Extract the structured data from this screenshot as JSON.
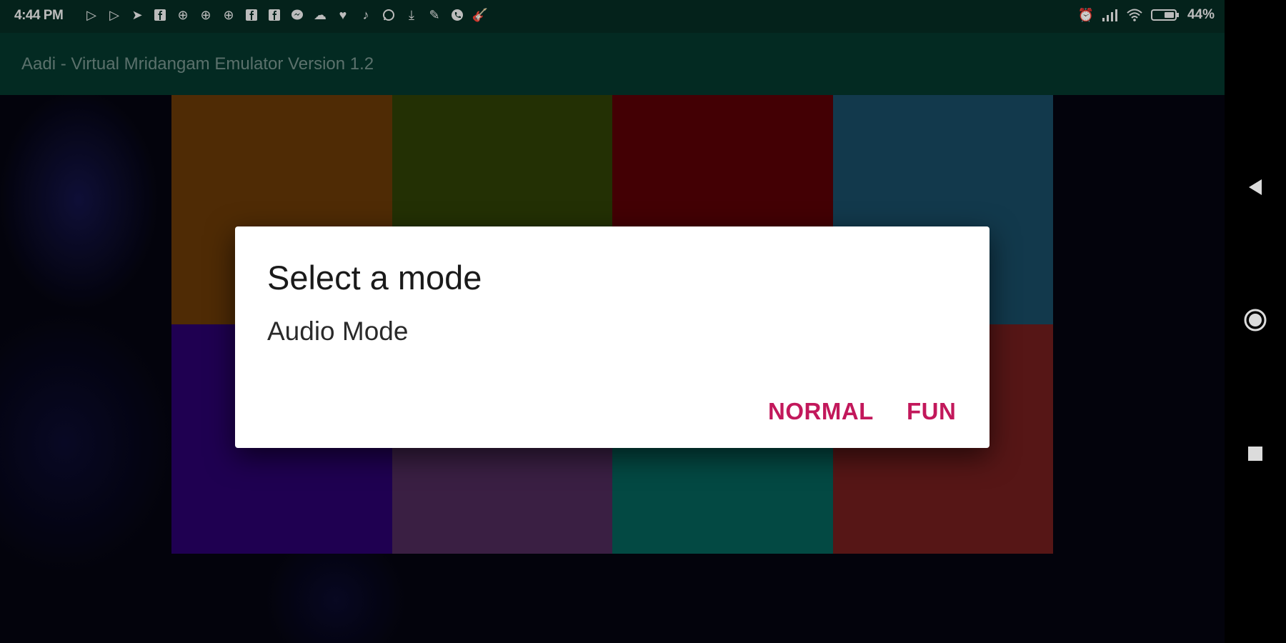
{
  "status_bar": {
    "time": "4:44 PM",
    "battery_percent": "44%",
    "notification_icons": [
      "play-store-icon",
      "play-store-icon",
      "telegram-icon",
      "facebook-icon",
      "crosshair-icon",
      "crosshair-icon",
      "crosshair-icon",
      "facebook-icon",
      "facebook-icon",
      "messenger-icon",
      "cloud-icon",
      "heart-icon",
      "tiktok-icon",
      "whatsapp-icon",
      "download-icon",
      "pen-icon",
      "phone-icon",
      "guitar-icon"
    ],
    "system_icons": [
      "alarm-icon",
      "signal-icon",
      "wifi-icon",
      "battery-icon"
    ]
  },
  "app_bar": {
    "title": "Aadi - Virtual Mridangam Emulator Version 1.2"
  },
  "pads": [
    {
      "color": "#613507"
    },
    {
      "color": "#2b3b06"
    },
    {
      "color": "#520105"
    },
    {
      "color": "#17465d"
    },
    {
      "color": "#270063"
    },
    {
      "color": "#472752"
    },
    {
      "color": "#045a52"
    },
    {
      "color": "#6a1c1c"
    }
  ],
  "dialog": {
    "title": "Select a mode",
    "message": "Audio Mode",
    "buttons": {
      "normal": "NORMAL",
      "fun": "FUN"
    },
    "accent_color": "#c2185b"
  },
  "nav_bar": {
    "icons": [
      "back-icon",
      "home-icon",
      "recents-icon"
    ]
  }
}
